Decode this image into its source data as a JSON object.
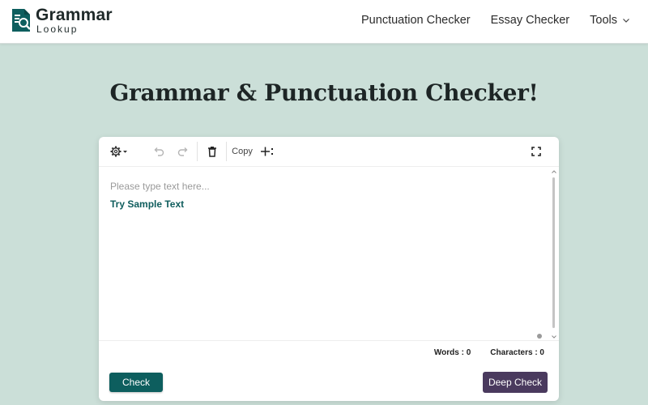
{
  "header": {
    "logo": {
      "name": "Grammar",
      "sub": "Lookup"
    },
    "nav": [
      {
        "label": "Punctuation Checker"
      },
      {
        "label": "Essay Checker"
      },
      {
        "label": "Tools"
      }
    ]
  },
  "hero": {
    "title": "Grammar & Punctuation Checker!"
  },
  "editor": {
    "toolbar": {
      "copy_label": "Copy"
    },
    "placeholder": "Please type text here...",
    "sample_link": "Try Sample Text",
    "stats": {
      "words": "Words : 0",
      "characters": "Characters : 0"
    },
    "check_label": "Check",
    "deep_check_label": "Deep Check"
  },
  "colors": {
    "background": "#cbdfd8",
    "brand": "#0d5e5e",
    "deep_check": "#4a3a5e"
  },
  "icons": [
    "logo-icon",
    "gear-icon",
    "undo-icon",
    "redo-icon",
    "trash-icon",
    "add-column-icon",
    "fullscreen-icon",
    "chevron-down-icon"
  ]
}
